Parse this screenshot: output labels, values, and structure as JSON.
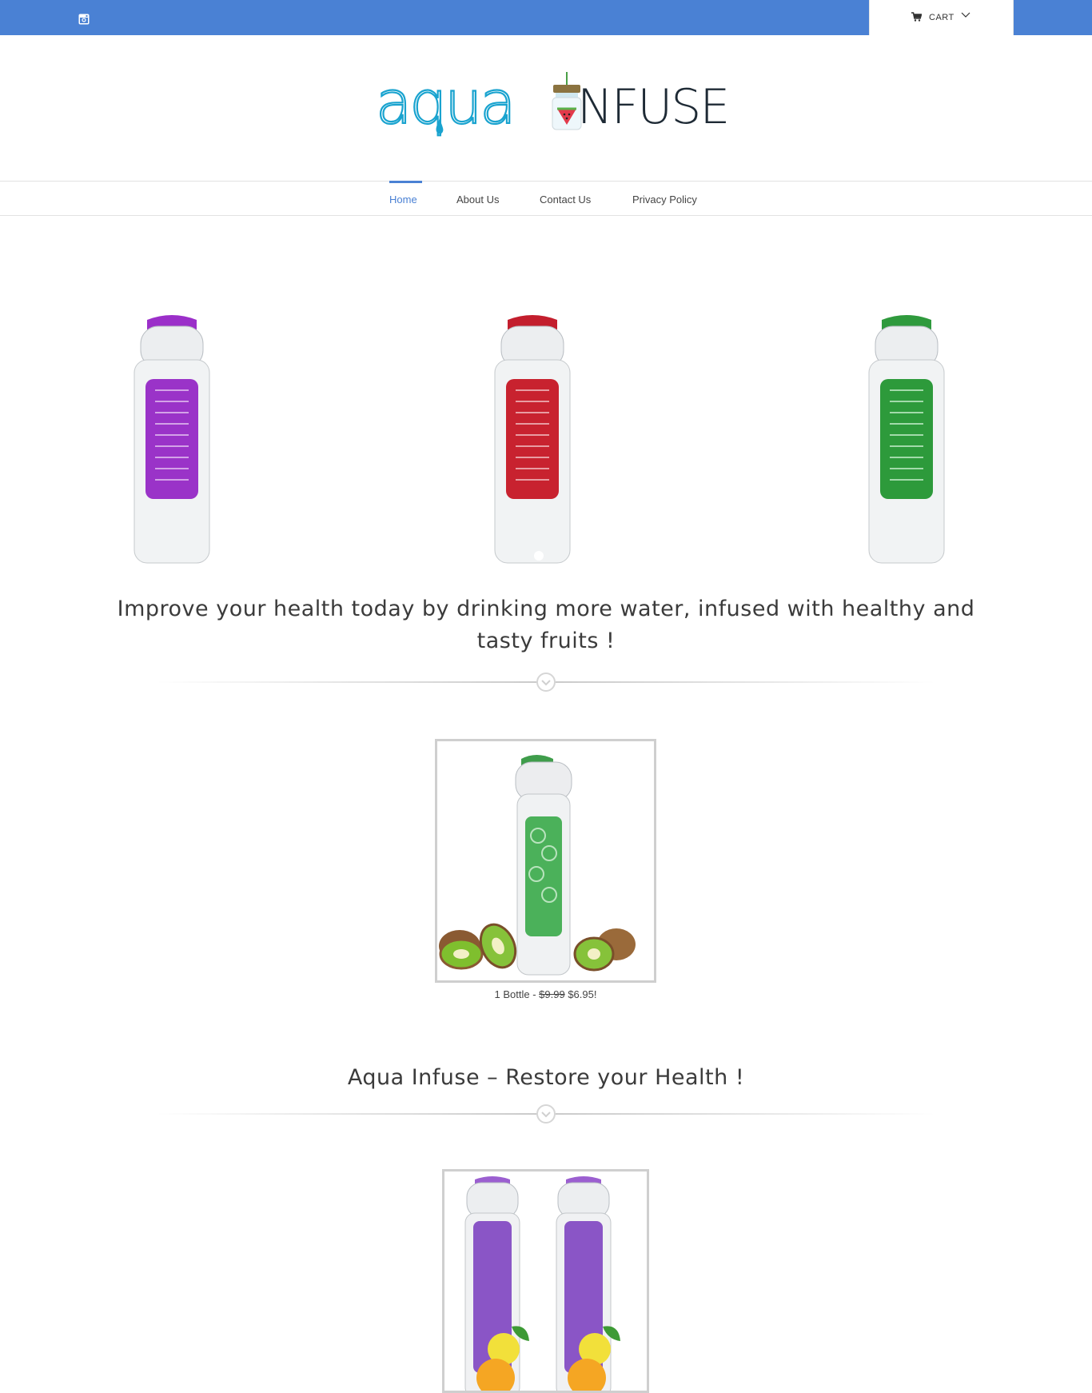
{
  "topbar": {
    "cart_label": "CART",
    "colors": {
      "bar": "#4a81d4"
    }
  },
  "logo": {
    "text_left": "aqua",
    "text_right": "NFUSE"
  },
  "nav": {
    "items": [
      {
        "label": "Home"
      },
      {
        "label": "About Us"
      },
      {
        "label": "Contact Us"
      },
      {
        "label": "Privacy Policy"
      }
    ]
  },
  "hero": {
    "tagline": "Improve your health today by drinking more water, infused with healthy and tasty fruits !"
  },
  "product": {
    "caption_prefix": "1 Bottle - ",
    "old_price": "$9.99",
    "new_price": "$6.95!"
  },
  "section2": {
    "title": "Aqua Infuse – Restore your Health !"
  }
}
